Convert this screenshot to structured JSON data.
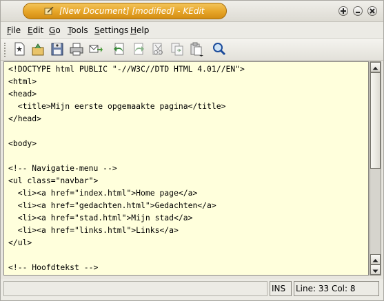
{
  "window": {
    "title": "[New Document] [modified] - KEdit",
    "controls": [
      "sticky-icon",
      "minimize-icon",
      "close-icon"
    ]
  },
  "menu": {
    "items": [
      {
        "label": "File",
        "mnemonic": "F"
      },
      {
        "label": "Edit",
        "mnemonic": "E"
      },
      {
        "label": "Go",
        "mnemonic": "G"
      },
      {
        "label": "Tools",
        "mnemonic": "T"
      },
      {
        "label": "Settings",
        "mnemonic": "S"
      },
      {
        "label": "Help",
        "mnemonic": "H"
      }
    ]
  },
  "toolbar": {
    "buttons": [
      "new-icon",
      "open-icon",
      "save-icon",
      "print-icon",
      "mail-icon",
      "undo-icon",
      "redo-icon",
      "cut-icon",
      "copy-icon",
      "paste-icon",
      "find-icon"
    ]
  },
  "editor": {
    "lines": [
      "<!DOCTYPE html PUBLIC \"-//W3C//DTD HTML 4.01//EN\">",
      "<html>",
      "<head>",
      "  <title>Mijn eerste opgemaakte pagina</title>",
      "</head>",
      "",
      "<body>",
      "",
      "<!-- Navigatie-menu -->",
      "<ul class=\"navbar\">",
      "  <li><a href=\"index.html\">Home page</a>",
      "  <li><a href=\"gedachten.html\">Gedachten</a>",
      "  <li><a href=\"stad.html\">Mijn stad</a>",
      "  <li><a href=\"links.html\">Links</a>",
      "</ul>",
      "",
      "<!-- Hoofdtekst -->"
    ]
  },
  "status": {
    "mode": "INS",
    "position": "Line: 33 Col: 8"
  },
  "colors": {
    "editor_background": "#ffffdc",
    "title_accent": "#e6a528"
  }
}
